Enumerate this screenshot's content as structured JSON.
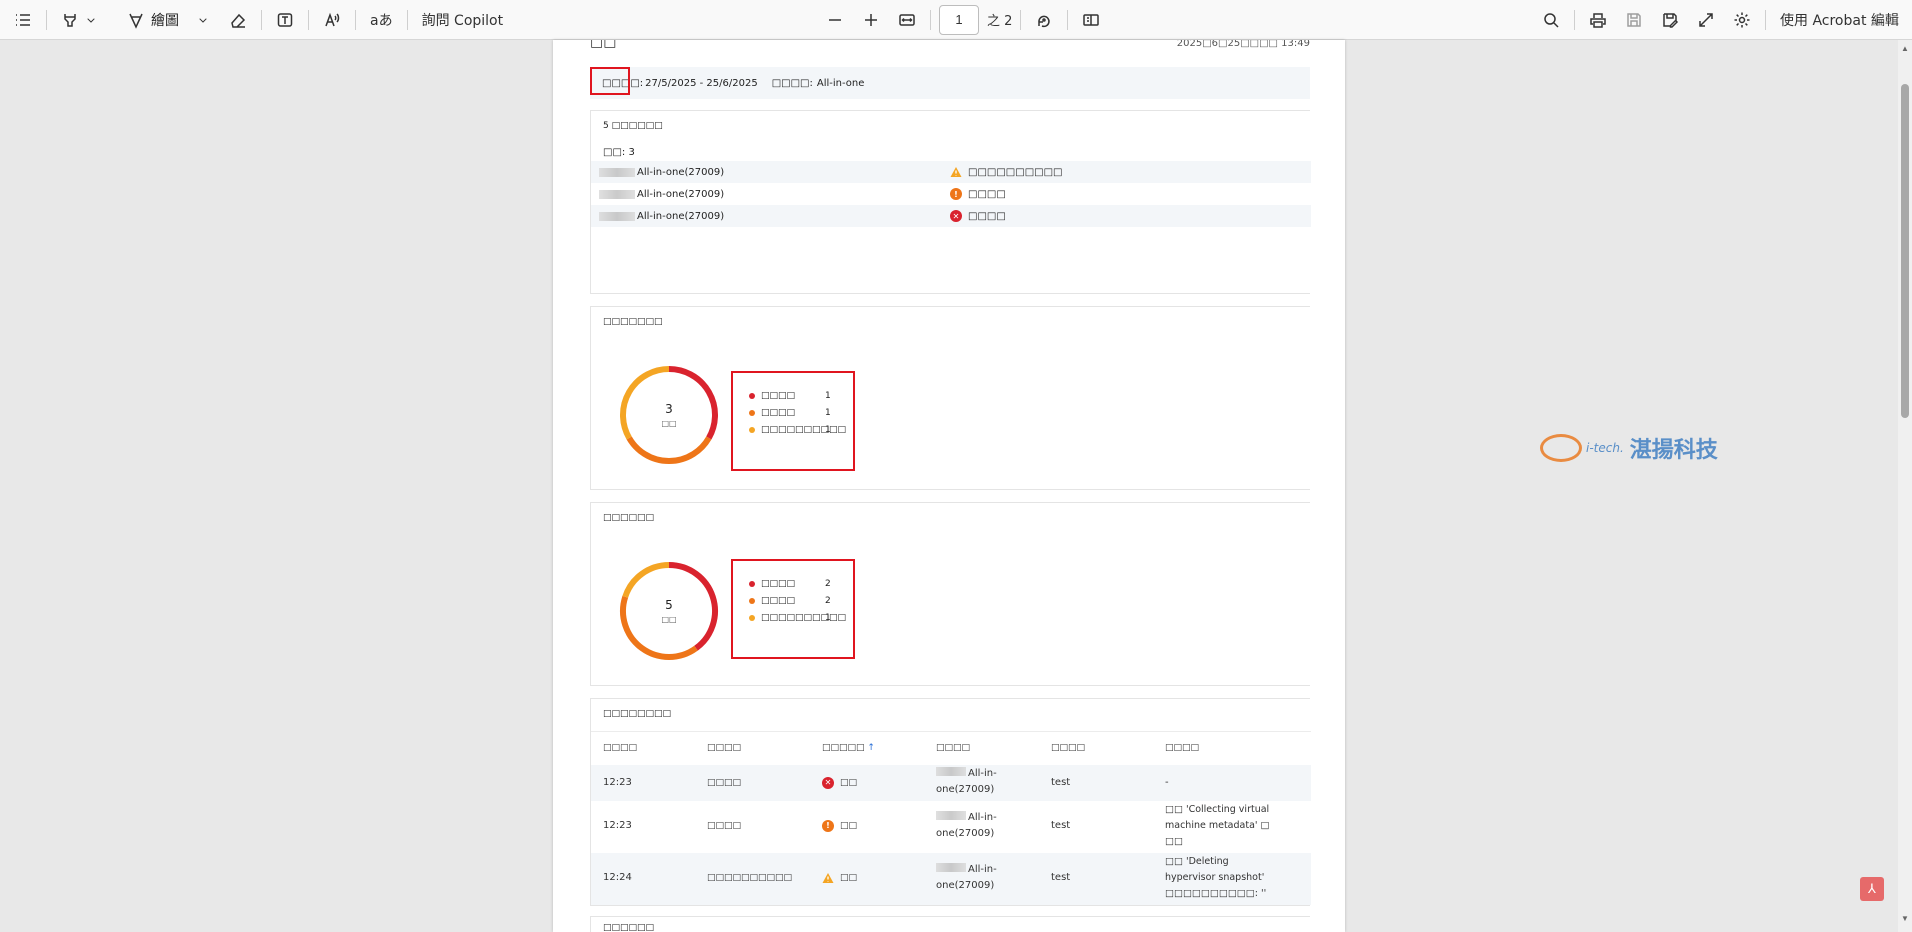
{
  "toolbar": {
    "draw_label": "繪圖",
    "copilot_label": "詢問 Copilot",
    "page_current": "1",
    "page_of": "之 2",
    "edit_label": "使用 Acrobat 編輯",
    "icons": [
      "list-icon",
      "highlight-icon",
      "chevron-down-icon",
      "draw-icon",
      "chevron-down-icon",
      "eraser-icon",
      "textbox-icon",
      "read-aloud-icon",
      "translate-icon",
      "zoom-out-icon",
      "zoom-in-icon",
      "fit-width-icon",
      "rotate-icon",
      "page-view-icon",
      "search-icon",
      "print-icon",
      "save-icon",
      "save-as-icon",
      "fullscreen-icon",
      "settings-icon"
    ]
  },
  "page": {
    "title": "□□",
    "generated": "2025□6□25□□□□ 13:49",
    "filter": {
      "range_label": "□□□□:",
      "range_value": "27/5/2025 - 25/6/2025",
      "type_label": "□□□□:",
      "type_value": "All-in-one"
    },
    "summary": {
      "title": "5 □□□□□□",
      "count_label": "□□: 3",
      "rows": [
        {
          "name": "All-in-one(27009)",
          "status": "□□□□□□□□□□",
          "status_type": "warning"
        },
        {
          "name": "All-in-one(27009)",
          "status": "□□□□",
          "status_type": "error-orange"
        },
        {
          "name": "All-in-one(27009)",
          "status": "□□□□",
          "status_type": "error-red"
        }
      ]
    },
    "chart1": {
      "title": "□□□□□□□",
      "total": "3",
      "total_label": "□□"
    },
    "chart2": {
      "title": "□□□□□□",
      "total": "5",
      "total_label": "□□"
    },
    "table": {
      "title": "□□□□□□□□",
      "headers": [
        "□□□□",
        "□□□□",
        "□□□□□",
        "□□□□",
        "□□□□",
        "□□□□"
      ],
      "sort_arrow": "↑",
      "rows": [
        {
          "time": "12:23",
          "type": "□□□□",
          "status": "□□",
          "status_type": "error-red",
          "source_a": "All-in-",
          "source_b": "one(27009)",
          "user": "test",
          "desc": [
            "-"
          ]
        },
        {
          "time": "12:23",
          "type": "□□□□",
          "status": "□□",
          "status_type": "error-orange",
          "source_a": "All-in-",
          "source_b": "one(27009)",
          "user": "test",
          "desc": [
            "□□ 'Collecting virtual",
            "machine metadata' □",
            "□□"
          ]
        },
        {
          "time": "12:24",
          "type": "□□□□□□□□□□",
          "status": "□□",
          "status_type": "warning",
          "source_a": "All-in-",
          "source_b": "one(27009)",
          "user": "test",
          "desc": [
            "□□ 'Deleting",
            "hypervisor snapshot'",
            "□□□□□□□□□□: ''"
          ]
        }
      ]
    },
    "next_section": "□□□□□□"
  },
  "chart_data": [
    {
      "type": "pie",
      "categories": [
        "□□□□",
        "□□□□",
        "□□□□□□□□□□"
      ],
      "values": [
        1,
        1,
        1
      ],
      "colors": [
        "#d9232e",
        "#ee7518",
        "#f4a524"
      ]
    },
    {
      "type": "pie",
      "categories": [
        "□□□□",
        "□□□□",
        "□□□□□□□□□□"
      ],
      "values": [
        2,
        2,
        1
      ],
      "colors": [
        "#d9232e",
        "#ee7518",
        "#f4a524"
      ]
    }
  ],
  "watermark": {
    "brand": "i-tech.",
    "name": "湛揚科技"
  },
  "colors": {
    "accent_red": "#e0151f",
    "orange": "#ee7518",
    "amber": "#f4a524",
    "red": "#d9232e"
  }
}
